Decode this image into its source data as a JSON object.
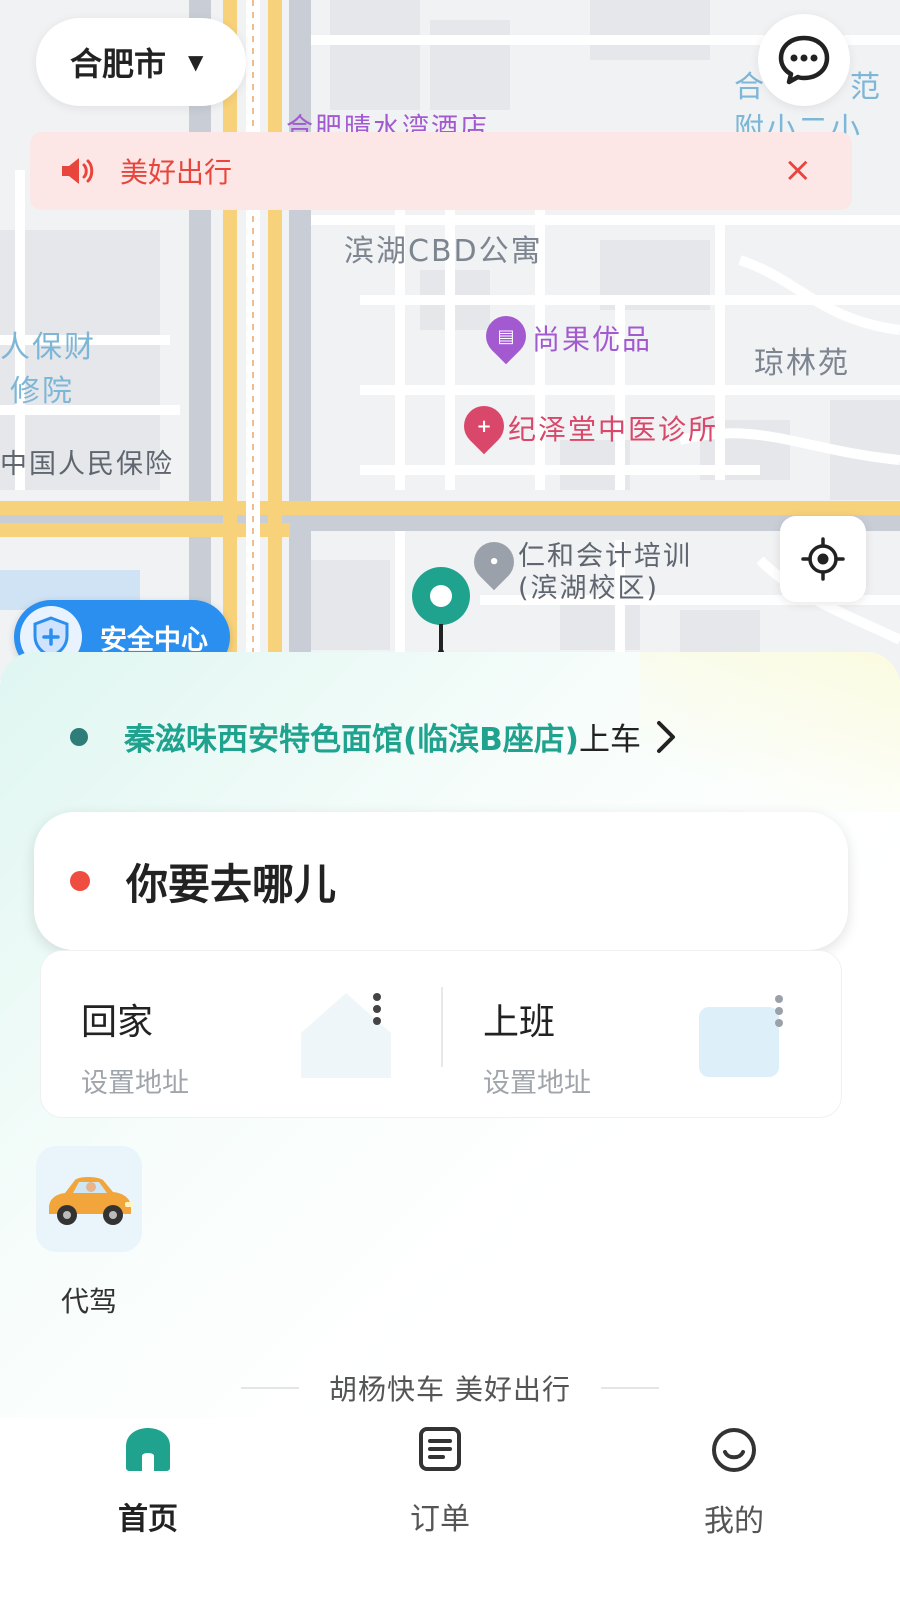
{
  "map": {
    "city": "合肥市",
    "labels": {
      "hotel": "合肥晴水湾酒店",
      "apartment": "滨湖CBD公寓",
      "shop": "尚果优品",
      "clinic": "纪泽堂中医诊所",
      "garden": "琼林苑",
      "insurance_a": "人保财",
      "insurance_b": "修院",
      "insurance_c": "中国人民保险",
      "school_a": "合",
      "school_b": "附小二小",
      "school_c": "范",
      "training_a": "仁和会计培训",
      "training_b": "(滨湖校区)"
    }
  },
  "notice": {
    "text": "美好出行",
    "close": "×"
  },
  "safety": {
    "label": "安全中心"
  },
  "pickup": {
    "place": "秦滋味西安特色面馆(临滨B座店)",
    "suffix": "上车",
    "chevron": "›"
  },
  "destination": {
    "prompt": "你要去哪儿"
  },
  "quick": {
    "home": {
      "title": "回家",
      "sub": "设置地址"
    },
    "work": {
      "title": "上班",
      "sub": "设置地址"
    },
    "more": "⋮"
  },
  "services": [
    {
      "label": "代驾"
    }
  ],
  "slogan": "胡杨快车 美好出行",
  "tabs": {
    "home": "首页",
    "orders": "订单",
    "mine": "我的"
  },
  "colors": {
    "accent": "#1fa38f",
    "alert": "#e8453c",
    "safety": "#2b8ff0"
  }
}
